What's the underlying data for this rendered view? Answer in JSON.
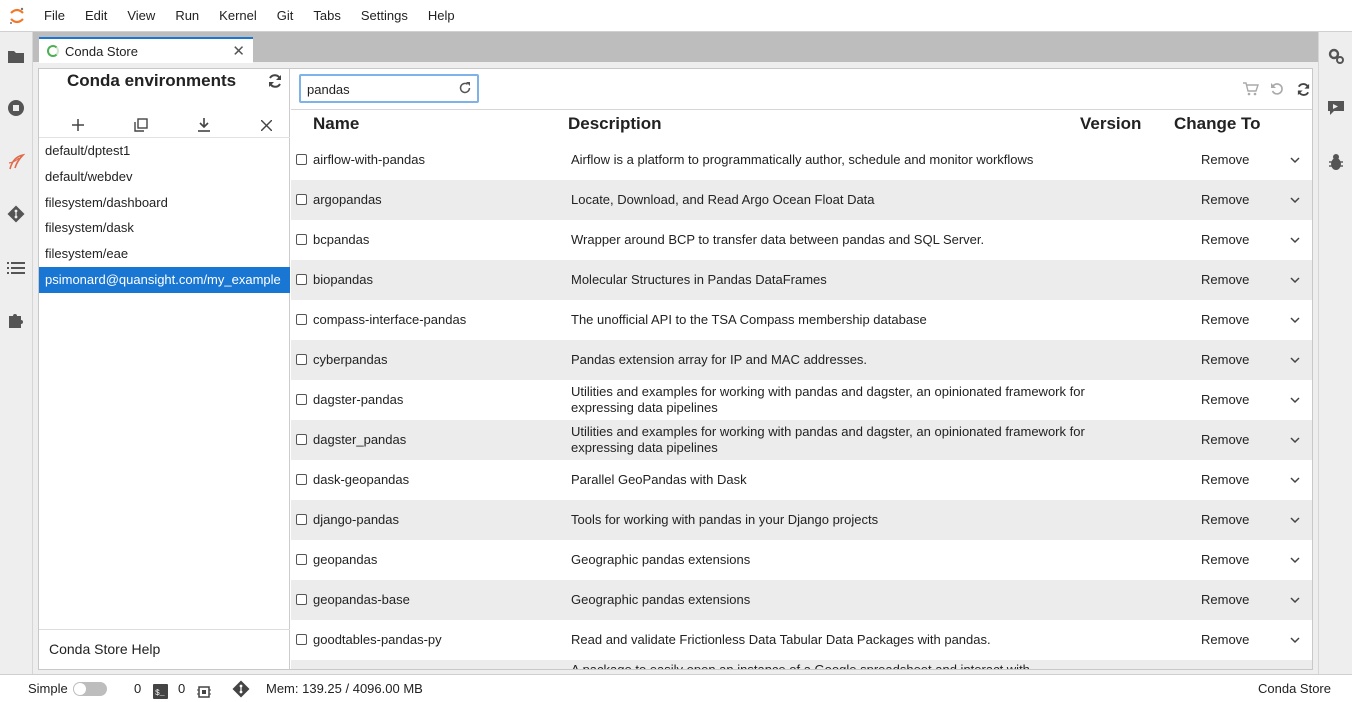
{
  "menubar": {
    "items": [
      "File",
      "Edit",
      "View",
      "Run",
      "Kernel",
      "Git",
      "Tabs",
      "Settings",
      "Help"
    ]
  },
  "tab": {
    "title": "Conda Store"
  },
  "env_panel": {
    "title": "Conda environments",
    "environments": [
      "default/dptest1",
      "default/webdev",
      "filesystem/dashboard",
      "filesystem/dask",
      "filesystem/eae",
      "psimonard@quansight.com/my_example"
    ],
    "selected_index": 5,
    "help_label": "Conda Store Help"
  },
  "search": {
    "value": "pandas"
  },
  "table": {
    "headers": {
      "name": "Name",
      "description": "Description",
      "version": "Version",
      "change_to": "Change To"
    },
    "rows": [
      {
        "name": "airflow-with-pandas",
        "description": "Airflow is a platform to programmatically author, schedule and monitor workflows",
        "action": "Remove"
      },
      {
        "name": "argopandas",
        "description": "Locate, Download, and Read Argo Ocean Float Data",
        "action": "Remove"
      },
      {
        "name": "bcpandas",
        "description": "Wrapper around BCP to transfer data between pandas and SQL Server.",
        "action": "Remove"
      },
      {
        "name": "biopandas",
        "description": "Molecular Structures in Pandas DataFrames",
        "action": "Remove"
      },
      {
        "name": "compass-interface-pandas",
        "description": "The unofficial API to the TSA Compass membership database",
        "action": "Remove"
      },
      {
        "name": "cyberpandas",
        "description": "Pandas extension array for IP and MAC addresses.",
        "action": "Remove"
      },
      {
        "name": "dagster-pandas",
        "description": "Utilities and examples for working with pandas and dagster, an opinionated framework for expressing data pipelines",
        "action": "Remove"
      },
      {
        "name": "dagster_pandas",
        "description": "Utilities and examples for working with pandas and dagster, an opinionated framework for expressing data pipelines",
        "action": "Remove"
      },
      {
        "name": "dask-geopandas",
        "description": "Parallel GeoPandas with Dask",
        "action": "Remove"
      },
      {
        "name": "django-pandas",
        "description": "Tools for working with pandas in your Django projects",
        "action": "Remove"
      },
      {
        "name": "geopandas",
        "description": "Geographic pandas extensions",
        "action": "Remove"
      },
      {
        "name": "geopandas-base",
        "description": "Geographic pandas extensions",
        "action": "Remove"
      },
      {
        "name": "goodtables-pandas-py",
        "description": "Read and validate Frictionless Data Tabular Data Packages with pandas.",
        "action": "Remove"
      },
      {
        "name": "",
        "description": "A package to easily open an instance of a Google spreadsheet and interact with",
        "action": ""
      }
    ]
  },
  "statusbar": {
    "simple_label": "Simple",
    "terminals_count": "0",
    "kernels_count": "0",
    "memory": "Mem: 139.25 / 4096.00 MB",
    "right_label": "Conda Store"
  },
  "colors": {
    "accent": "#1976d2",
    "row_alt": "#ececec"
  }
}
